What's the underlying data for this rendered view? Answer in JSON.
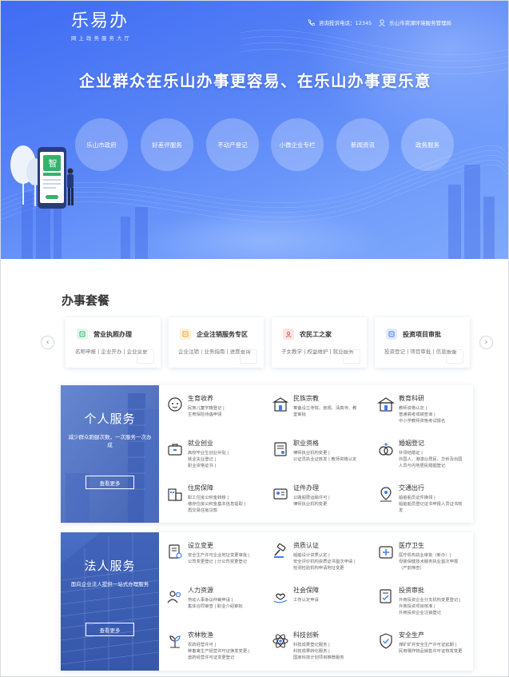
{
  "header": {
    "logo_title": "乐易办",
    "logo_subtitle": "网上政务服务大厅",
    "hotline": "咨询投诉电话：12345",
    "user": "乐山市资源环境服务管理局"
  },
  "hero": {
    "slogan": "企业群众在乐山办事更容易、在乐山办事更乐意",
    "phone_badge": "智",
    "nav": [
      "乐山市政府",
      "好差评服务",
      "不动产登记",
      "小微企业专栏",
      "新闻资讯",
      "政务服务"
    ]
  },
  "packages": {
    "title": "办事套餐",
    "cards": [
      {
        "title": "营业执照办理",
        "links": "名称申报 | 企业开办 | 企业变更",
        "color": "#2bb673",
        "icon": "license-icon"
      },
      {
        "title": "企业注销服务专区",
        "links": "企业注销 | 业务指南 | 进度查询",
        "color": "#f5a623",
        "icon": "cancel-icon"
      },
      {
        "title": "农民工之家",
        "links": "子女教学 | 权益维护 | 就业服务",
        "color": "#ef5a5a",
        "icon": "worker-icon"
      },
      {
        "title": "投资项目审批",
        "links": "投资登记 | 项目审批 | 信息报备",
        "color": "#3f7cf3",
        "icon": "investment-icon"
      }
    ]
  },
  "personal": {
    "title": "个人服务",
    "desc": "减少群众跑腿次数，一次服务一次办成",
    "more": "查看更多",
    "items": [
      {
        "name": "生育收养",
        "icon": "baby-icon",
        "lines": [
          "民族儿童学籍登记 |",
          "生育保险待遇申领"
        ]
      },
      {
        "name": "民族宗教",
        "icon": "temple-icon",
        "lines": [
          "筹备设立寺院、宫观、清真寺、教",
          "堂审批"
        ]
      },
      {
        "name": "教育科研",
        "icon": "school-icon",
        "lines": [
          "教师资格认定 |",
          "普通高考成绩查询 |",
          "中小学教师资格考试报名"
        ]
      },
      {
        "name": "就业创业",
        "icon": "briefcase-icon",
        "lines": [
          "高校毕业生创业补贴 |",
          "就业失业登记 |",
          "职业资格证书 |"
        ]
      },
      {
        "name": "职业资格",
        "icon": "certificate-icon",
        "lines": [
          "律师执业机构变更 |",
          "公证员执业证核发 | 教师资格认定"
        ]
      },
      {
        "name": "婚姻登记",
        "icon": "marriage-icon",
        "lines": [
          "补领结婚证 |",
          "外国人、港澳台居民、华侨及出国",
          "人员与内地居民婚姻登记"
        ]
      },
      {
        "name": "住房保障",
        "icon": "house-icon",
        "lines": [
          "职工住房公积金转移 |",
          "缴存住房公积金基本信息提取 |",
          "再交易住房贷款"
        ]
      },
      {
        "name": "证件办理",
        "icon": "id-card-icon",
        "lines": [
          "公路超限运输许可 |",
          "律师执业机构变更"
        ]
      },
      {
        "name": "交通出行",
        "icon": "location-icon",
        "lines": [
          "船舶船员证件换领 |",
          "船舶船员登记证书申报人员证书核",
          "发"
        ]
      }
    ]
  },
  "legal": {
    "title": "法人服务",
    "desc": "面向企业法人提供一站式办理服务",
    "more": "查看更多",
    "items": [
      {
        "name": "设立变更",
        "icon": "register-icon",
        "lines": [
          "安全生产许可企业地址变更审批 |",
          "公司变更登记 | 分公司变更登记"
        ]
      },
      {
        "name": "资质认证",
        "icon": "gavel-icon",
        "lines": [
          "船舶设计资质认定 |",
          "安全评价机构资质证书首次申请 |",
          "检测检验机构申请地址变更"
        ]
      },
      {
        "name": "医疗卫生",
        "icon": "medical-icon",
        "lines": [
          "医疗机构执业审批（新办）|",
          "母婴保健技术服务执业首次申报",
          "（产前筛查）"
        ]
      },
      {
        "name": "人力资源",
        "icon": "people-icon",
        "lines": [
          "劳动人事争议仲裁申请 |",
          "集体合同审查 | 职业介绍审批"
        ]
      },
      {
        "name": "社会保障",
        "icon": "hand-heart-icon",
        "lines": [
          "工伤认定申请"
        ]
      },
      {
        "name": "投资审批",
        "icon": "approval-icon",
        "lines": [
          "外商投资企业分支机构变更登记 |",
          "外商投资项目核准 |",
          "外商投资企业注销登记"
        ]
      },
      {
        "name": "农林牧渔",
        "icon": "sprout-icon",
        "lines": [
          "农药经营许可 |",
          "种畜禽生产经营许可证换发变更 |",
          "兽药经营许可证变更登记"
        ]
      },
      {
        "name": "科技创新",
        "icon": "atom-icon",
        "lines": [
          "科技成果登记服务 |",
          "科技成果转化服务 |",
          "国家科技计划项目推荐服务"
        ]
      },
      {
        "name": "安全生产",
        "icon": "shield-check-icon",
        "lines": [
          "煤矿矿井安全生产许可证延期 |",
          "民用爆炸物品销售许可证核发变更"
        ]
      }
    ]
  }
}
